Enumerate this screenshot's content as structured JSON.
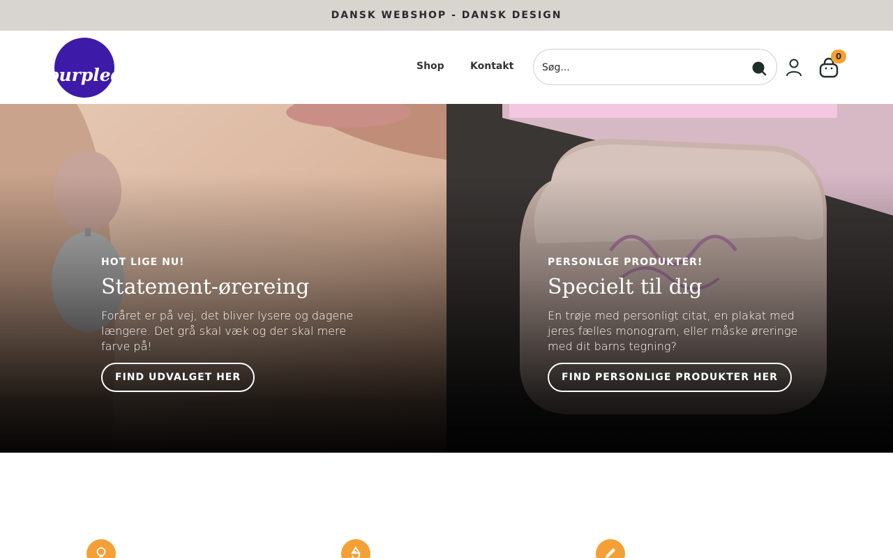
{
  "announcement": "DANSK WEBSHOP - DANSK DESIGN",
  "header": {
    "logo_text": "purpledot",
    "nav": [
      {
        "label": "Shop"
      },
      {
        "label": "Kontakt"
      }
    ],
    "search": {
      "placeholder": "Søg..."
    },
    "cart_count": "0"
  },
  "heroes": [
    {
      "eyebrow": "HOT LIGE NU!",
      "title": "Statement-ørereing",
      "text": "Foråret er på vej, det bliver lysere og dagene længere. Det grå skal væk og der skal mere farve på!",
      "button": "FIND UDVALGET HER"
    },
    {
      "eyebrow": "PERSONLGE PRODUKTER!",
      "title": "Specielt til dig",
      "text": "En trøje med personligt citat, en plakat med jeres fælles monogram, eller måske øreringe med dit barns tegning?",
      "button": "FIND PERSONLIGE PRODUKTER HER"
    }
  ],
  "features": [
    {
      "icon": "lightbulb-icon"
    },
    {
      "icon": "recycle-icon"
    },
    {
      "icon": "pencil-icon"
    }
  ],
  "colors": {
    "brand_purple": "#3d1aa8",
    "accent_orange": "#f5a036",
    "announcement_bg": "#d8d4d0"
  }
}
